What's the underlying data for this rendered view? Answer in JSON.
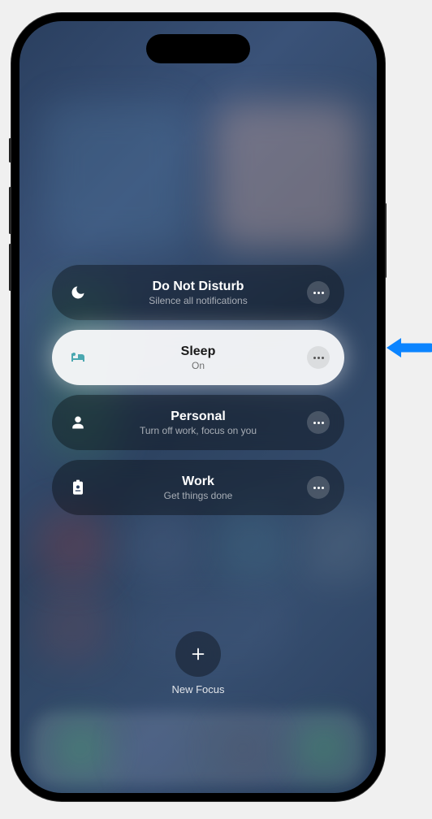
{
  "focus_modes": [
    {
      "title": "Do Not Disturb",
      "subtitle": "Silence all notifications",
      "icon": "moon"
    },
    {
      "title": "Sleep",
      "subtitle": "On",
      "icon": "bed"
    },
    {
      "title": "Personal",
      "subtitle": "Turn off work, focus on you",
      "icon": "person"
    },
    {
      "title": "Work",
      "subtitle": "Get things done",
      "icon": "badge"
    }
  ],
  "new_focus": {
    "label": "New Focus"
  }
}
